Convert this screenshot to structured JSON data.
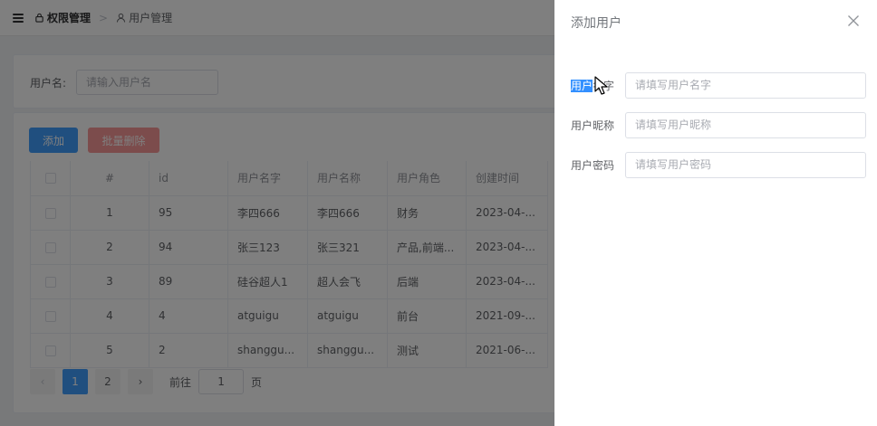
{
  "header": {
    "breadcrumb": [
      {
        "label": "权限管理",
        "icon": "lock-icon"
      },
      {
        "label": "用户管理",
        "icon": "user-icon"
      }
    ],
    "separator": ">"
  },
  "search": {
    "label": "用户名:",
    "placeholder": "请输入用户名"
  },
  "toolbar": {
    "add_label": "添加",
    "batch_delete_label": "批量删除"
  },
  "table": {
    "columns": [
      "#",
      "id",
      "用户名字",
      "用户名称",
      "用户角色",
      "创建时间"
    ],
    "rows": [
      [
        "1",
        "95",
        "李四666",
        "李四666",
        "财务",
        "2023-04-..."
      ],
      [
        "2",
        "94",
        "张三123",
        "张三321",
        "产品,前端...",
        "2023-04-..."
      ],
      [
        "3",
        "89",
        "硅谷超人1",
        "超人会飞",
        "后端",
        "2023-04-..."
      ],
      [
        "4",
        "4",
        "atguigu",
        "atguigu",
        "前台",
        "2021-09-..."
      ],
      [
        "5",
        "2",
        "shanggu...",
        "shanggu...",
        "测试",
        "2021-06-..."
      ]
    ]
  },
  "pagination": {
    "prev": "‹",
    "pages": [
      "1",
      "2"
    ],
    "current": "1",
    "next": "›",
    "goto_label": "前往",
    "goto_value": "1",
    "goto_unit": "页"
  },
  "drawer": {
    "title": "添加用户",
    "fields": [
      {
        "label_selected": "用户",
        "label_rest": "名字",
        "placeholder": "请填写用户名字"
      },
      {
        "label": "用户昵称",
        "placeholder": "请填写用户昵称"
      },
      {
        "label": "用户密码",
        "placeholder": "请填写用户密码"
      }
    ]
  },
  "colors": {
    "primary": "#409eff",
    "danger_disabled": "#f89898",
    "selection": "#3390ff",
    "overlay": "rgba(0,0,0,0.5)"
  }
}
